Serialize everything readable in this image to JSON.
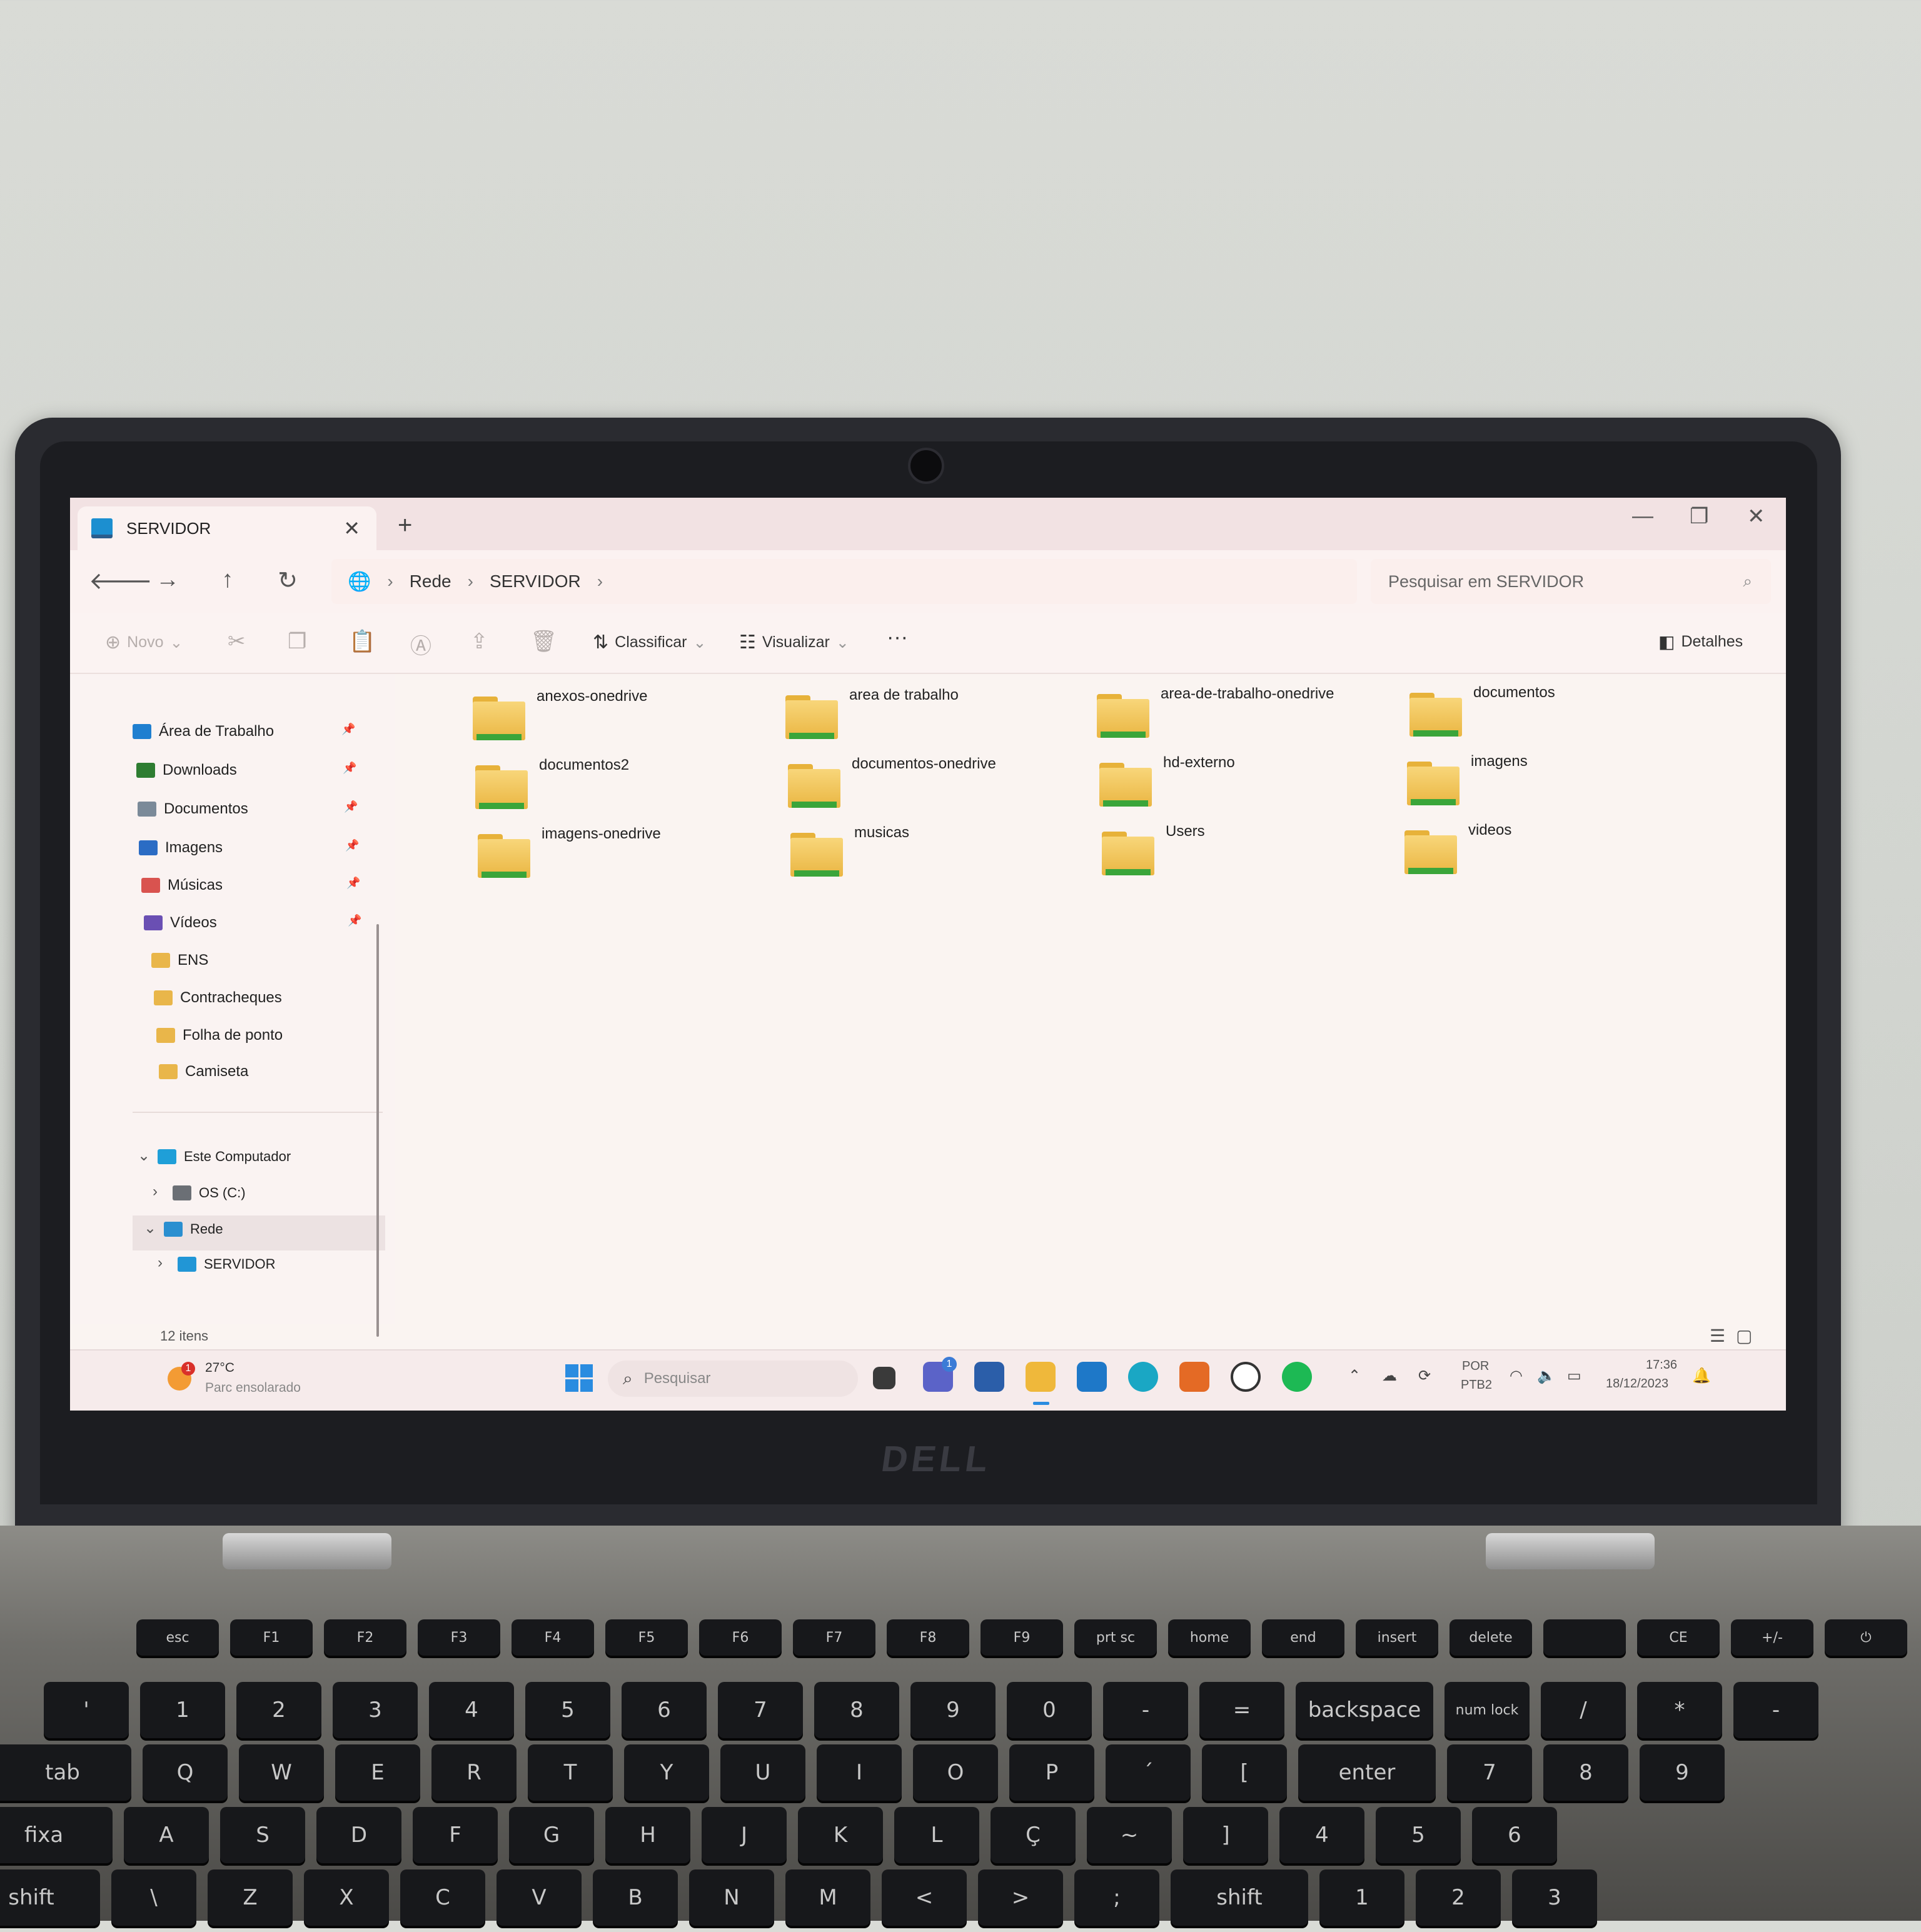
{
  "window": {
    "tab_title": "SERVIDOR",
    "tab_close": "✕",
    "new_tab": "+",
    "minimize": "—",
    "maximize": "❐",
    "close": "✕"
  },
  "nav": {
    "back": "🡐",
    "forward": "→",
    "up": "↑",
    "refresh": "↻",
    "breadcrumb": [
      "Rede",
      "SERVIDOR"
    ],
    "search_placeholder": "Pesquisar em SERVIDOR"
  },
  "commands": {
    "new": "Novo",
    "sort": "Classificar",
    "view": "Visualizar",
    "more": "···",
    "details": "Detalhes"
  },
  "sidebar": {
    "quick_access": [
      {
        "label": "Área de Trabalho",
        "color": "#1f7fd0",
        "pinned": true
      },
      {
        "label": "Downloads",
        "color": "#2e7d32",
        "pinned": true
      },
      {
        "label": "Documentos",
        "color": "#7b8a99",
        "pinned": true
      },
      {
        "label": "Imagens",
        "color": "#2b6cc4",
        "pinned": true
      },
      {
        "label": "Músicas",
        "color": "#d9534f",
        "pinned": true
      },
      {
        "label": "Vídeos",
        "color": "#6a4fb3",
        "pinned": true
      },
      {
        "label": "ENS",
        "color": "#e9b64a",
        "pinned": false
      },
      {
        "label": "Contracheques",
        "color": "#e9b64a",
        "pinned": false
      },
      {
        "label": "Folha de ponto",
        "color": "#e9b64a",
        "pinned": false
      },
      {
        "label": "Camiseta",
        "color": "#e9b64a",
        "pinned": false
      }
    ],
    "tree": [
      {
        "label": "Este Computador",
        "color": "#1f9fd8"
      },
      {
        "label": "OS (C:)",
        "color": "#6b6f75"
      },
      {
        "label": "Rede",
        "color": "#2a8fd0"
      },
      {
        "label": "SERVIDOR",
        "color": "#2196d6"
      }
    ]
  },
  "folders": [
    "anexos-onedrive",
    "area de trabalho",
    "area-de-trabalho-onedrive",
    "documentos",
    "documentos2",
    "documentos-onedrive",
    "hd-externo",
    "imagens",
    "imagens-onedrive",
    "musicas",
    "Users",
    "videos"
  ],
  "status": {
    "item_count": "12 itens"
  },
  "taskbar": {
    "weather_temp": "27°C",
    "weather_desc": "Parc ensolarado",
    "weather_badge": "1",
    "search_placeholder": "Pesquisar",
    "teams_badge": "1",
    "lang_top": "POR",
    "lang_bottom": "PTB2",
    "time": "17:36",
    "date": "18/12/2023"
  },
  "device": {
    "brand": "DELL"
  },
  "keyboard": {
    "row1": [
      "esc",
      "F1",
      "F2",
      "F3",
      "F4",
      "F5",
      "F6",
      "F7",
      "F8",
      "F9",
      "prt sc",
      "home",
      "end",
      "insert",
      "delete",
      "",
      "CE",
      "+/-",
      "⏻"
    ],
    "row2": [
      "'",
      "1",
      "2",
      "3",
      "4",
      "5",
      "6",
      "7",
      "8",
      "9",
      "0",
      "-",
      "=",
      "backspace",
      "num lock",
      "/",
      "*",
      "-"
    ],
    "row3": [
      "tab",
      "Q",
      "W",
      "E",
      "R",
      "T",
      "Y",
      "U",
      "I",
      "O",
      "P",
      "´",
      "[",
      "enter",
      "7",
      "8",
      "9"
    ],
    "row4": [
      "fixa",
      "A",
      "S",
      "D",
      "F",
      "G",
      "H",
      "J",
      "K",
      "L",
      "Ç",
      "~",
      "]",
      "4",
      "5",
      "6"
    ],
    "row5": [
      "shift",
      "\\",
      "Z",
      "X",
      "C",
      "V",
      "B",
      "N",
      "M",
      "<",
      ">",
      ";",
      "shift",
      "1",
      "2",
      "3"
    ]
  }
}
